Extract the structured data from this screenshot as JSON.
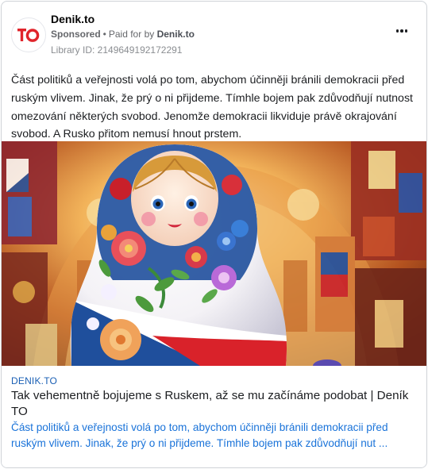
{
  "ad": {
    "page_name": "Denik.to",
    "sponsored_label": "Sponsored",
    "paid_for_label": "Paid for by",
    "paid_for_name": "Denik.to",
    "library_id": "Library ID: 2149649192172291",
    "logo_text": "TO",
    "body_text": "Část politiků a veřejnosti volá po tom, abychom účinněji bránili demokracii před ruským vlivem. Jinak, že prý o ni přijdeme. Tímhle bojem pak zdůvodňují nutnost omezování některých svobod. Jenomže demokracii likviduje právě okrajování svobod. A Rusko přitom nemusí hnout prstem.",
    "link": {
      "domain": "DENIK.TO",
      "title": "Tak vehementně bojujeme s Ruskem, až se mu začínáme podobat | Deník TO",
      "description": "Část politiků a veřejnosti volá po tom, abychom účinněji bránili demokracii před ruským vlivem. Jinak, že prý o ni přijdeme. Tímhle bojem pak zdůvodňují nut ..."
    }
  },
  "colors": {
    "brand_red": "#e0242b",
    "link_blue": "#1a73d9",
    "domain_blue": "#1a5fb4",
    "meta_gray": "#65676b"
  }
}
